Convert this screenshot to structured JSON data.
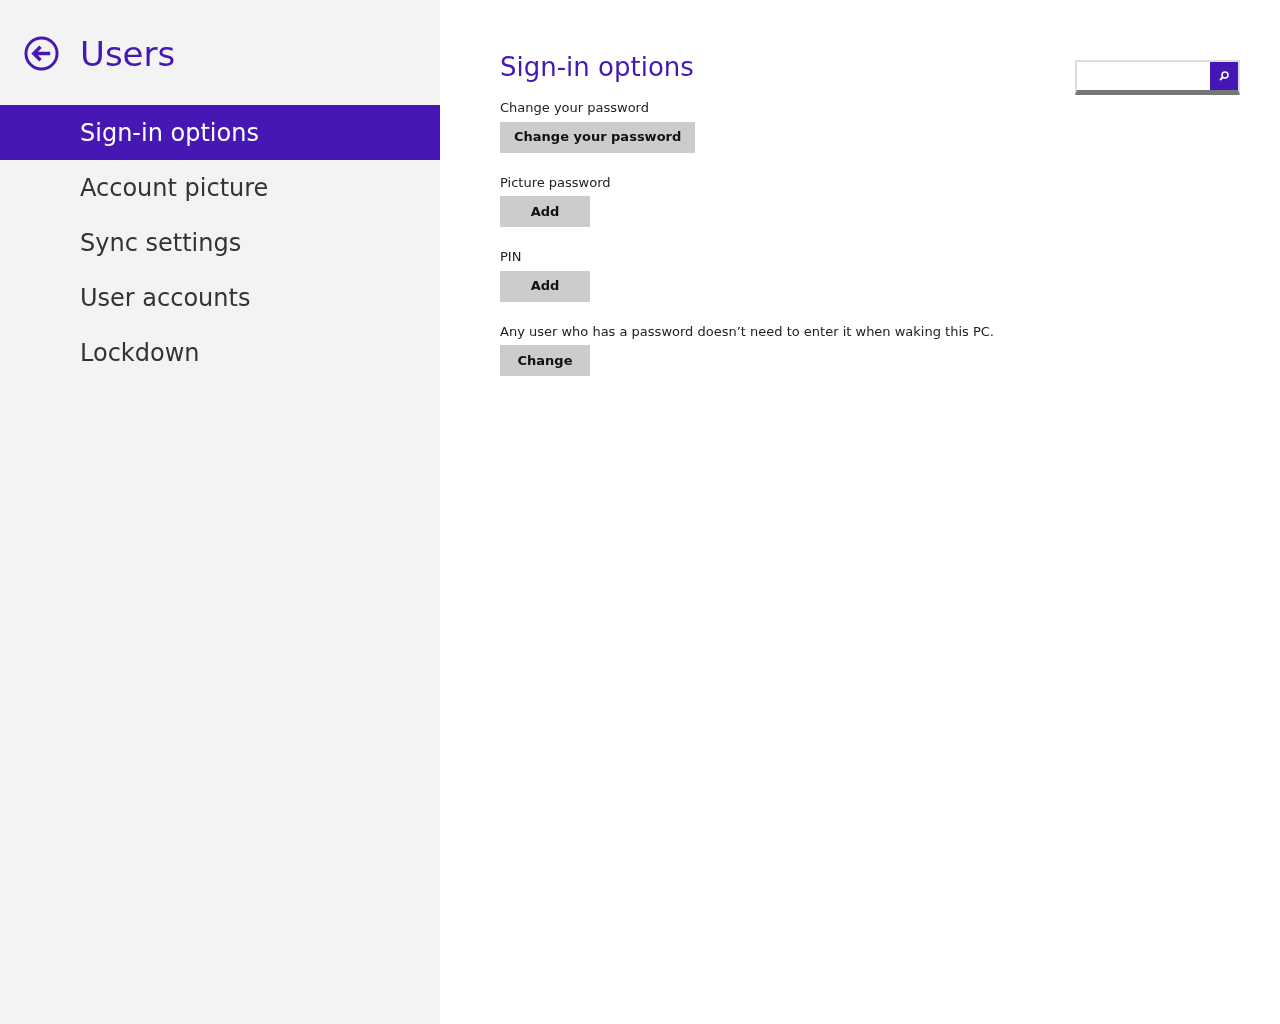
{
  "sidebar": {
    "title": "Users",
    "items": [
      {
        "label": "Sign-in options",
        "selected": true
      },
      {
        "label": "Account picture",
        "selected": false
      },
      {
        "label": "Sync settings",
        "selected": false
      },
      {
        "label": "User accounts",
        "selected": false
      },
      {
        "label": "Lockdown",
        "selected": false
      }
    ]
  },
  "content": {
    "heading": "Sign-in options",
    "sections": [
      {
        "label": "Change your password",
        "button": "Change your password"
      },
      {
        "label": "Picture password",
        "button": "Add"
      },
      {
        "label": "PIN",
        "button": "Add"
      },
      {
        "label": "Any user who has a password doesn’t need to enter it when waking this PC.",
        "button": "Change"
      }
    ]
  }
}
